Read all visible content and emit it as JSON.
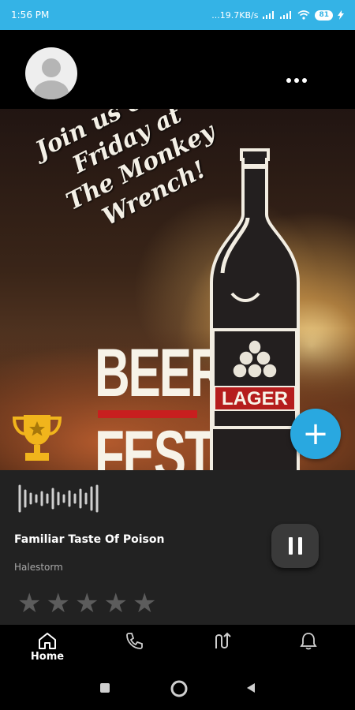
{
  "status_bar": {
    "time": "1:56 PM",
    "network_speed": "...19.7KB/s",
    "battery": "81"
  },
  "header": {
    "avatar_icon": "avatar-placeholder-icon",
    "more_icon": "more-dots-icon"
  },
  "poster": {
    "tagline_lines": [
      "Join us every",
      "Friday at",
      "The Monkey",
      "Wrench!"
    ],
    "beer_word": "BEER",
    "fest_word": "FEST",
    "bottle_label": "LAGER",
    "icons": [
      "trophy-icon",
      "beer-bottle-icon"
    ]
  },
  "fab": {
    "icon": "plus-icon",
    "label": "+"
  },
  "player": {
    "title": "Familiar Taste Of Poison",
    "artist": "Halestorm",
    "rating": 0,
    "max_rating": 5,
    "pause_icon": "pause-icon",
    "waveform_icon": "waveform-icon"
  },
  "nav": {
    "items": [
      {
        "icon": "home-icon",
        "label": "Home"
      },
      {
        "icon": "phone-icon",
        "label": ""
      },
      {
        "icon": "route-icon",
        "label": ""
      },
      {
        "icon": "bell-icon",
        "label": ""
      }
    ]
  },
  "system_nav": [
    "recents-square-icon",
    "home-circle-icon",
    "back-triangle-icon"
  ],
  "colors": {
    "status_bar": "#34b3e6",
    "fab": "#29a8e0",
    "player_bg": "#222222",
    "accent_red": "#c81f1f"
  }
}
